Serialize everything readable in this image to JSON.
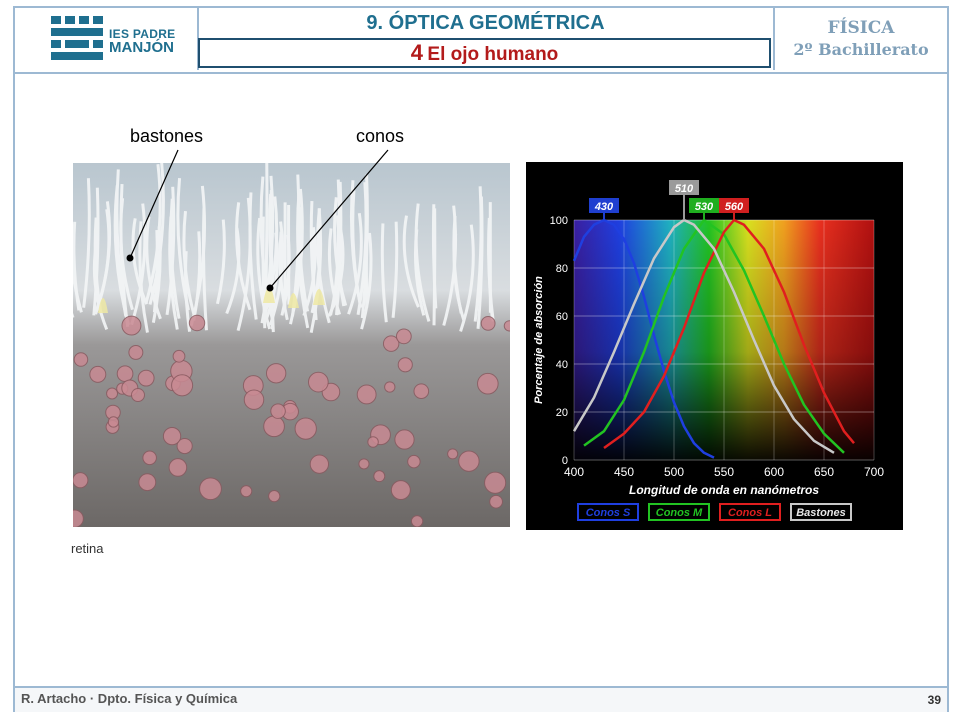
{
  "header": {
    "logo_line1": "IES PADRE",
    "logo_line2": "MANJÓN",
    "chapter": "9. ÓPTICA GEOMÉTRICA",
    "section_number": "4",
    "section_title": "El ojo humano",
    "course_line1": "FÍSICA",
    "course_line2": "2º Bachillerato"
  },
  "photo": {
    "label_rods": "bastones",
    "label_cones": "conos",
    "caption": "retina"
  },
  "footer": {
    "author": "R. Artacho · Dpto. Física y Química",
    "page": "39"
  },
  "colors": {
    "brand": "#1f6f8f",
    "title_red": "#b31b1b",
    "frame": "#9db9d3"
  },
  "chart_data": {
    "type": "line",
    "xlabel": "Longitud de onda en nanómetros",
    "ylabel": "Porcentaje de absorción",
    "xlim": [
      400,
      700
    ],
    "ylim": [
      0,
      100
    ],
    "x_ticks": [
      400,
      450,
      500,
      550,
      600,
      650,
      700
    ],
    "y_ticks": [
      0,
      20,
      40,
      60,
      80,
      100
    ],
    "grid": true,
    "legend_position": "bottom",
    "peak_labels": [
      {
        "text": "430",
        "x": 430,
        "color": "#1f3fd0"
      },
      {
        "text": "510",
        "x": 510,
        "color": "#9a9a9a"
      },
      {
        "text": "530",
        "x": 530,
        "color": "#1fae1f"
      },
      {
        "text": "560",
        "x": 560,
        "color": "#d01f1f"
      }
    ],
    "series": [
      {
        "name": "Conos S",
        "color": "#1f3fe0",
        "x": [
          400,
          410,
          420,
          430,
          440,
          450,
          460,
          470,
          480,
          490,
          500,
          510,
          520,
          530,
          540
        ],
        "values": [
          83,
          93,
          98,
          100,
          98,
          92,
          82,
          68,
          52,
          37,
          24,
          14,
          7,
          3,
          1
        ]
      },
      {
        "name": "Conos M",
        "color": "#22c322",
        "x": [
          410,
          430,
          450,
          470,
          490,
          510,
          530,
          550,
          570,
          590,
          610,
          630,
          650,
          670
        ],
        "values": [
          6,
          12,
          25,
          45,
          68,
          88,
          100,
          94,
          79,
          60,
          40,
          23,
          11,
          3
        ]
      },
      {
        "name": "Conos L",
        "color": "#e01f1f",
        "x": [
          430,
          450,
          470,
          490,
          510,
          530,
          550,
          560,
          570,
          590,
          610,
          630,
          650,
          670,
          680
        ],
        "values": [
          5,
          11,
          20,
          35,
          55,
          78,
          95,
          100,
          98,
          88,
          70,
          48,
          28,
          12,
          7
        ]
      },
      {
        "name": "Bastones",
        "color": "#c8c8c8",
        "x": [
          400,
          420,
          440,
          460,
          480,
          500,
          510,
          520,
          540,
          560,
          580,
          600,
          620,
          640,
          660
        ],
        "values": [
          12,
          26,
          45,
          65,
          84,
          97,
          100,
          98,
          88,
          70,
          50,
          31,
          17,
          8,
          3
        ]
      }
    ]
  }
}
